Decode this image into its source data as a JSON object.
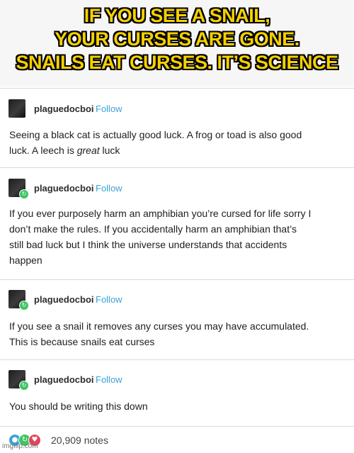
{
  "caption": {
    "lines": [
      "IF YOU SEE A SNAIL,",
      "YOUR CURSES ARE GONE.",
      "SNAILS EAT CURSES. IT’S SCIENCE"
    ]
  },
  "posts": [
    {
      "username": "plaguedocboi",
      "follow_label": "Follow",
      "text_lines": [
        "Seeing a black cat is actually good luck. A frog or toad is also good"
      ],
      "tail_before": "luck. A leech is ",
      "tail_em": "great",
      "tail_after": " luck",
      "avatar_icon": "avatar",
      "reblog": false
    },
    {
      "username": "plaguedocboi",
      "follow_label": "Follow",
      "text_lines": [
        "If you ever purposely harm an amphibian you’re cursed for life sorry I",
        "don’t make the rules. If you accidentally harm an amphibian that’s",
        "still bad luck but I think the universe understands that accidents",
        "happen"
      ],
      "reblog": true
    },
    {
      "username": "plaguedocboi",
      "follow_label": "Follow",
      "text_lines": [
        "If you see a snail it removes any curses you may have accumulated.",
        "This is because snails eat curses"
      ],
      "reblog": true
    },
    {
      "username": "plaguedocboi",
      "follow_label": "Follow",
      "text_lines": [
        "You should be writing this down"
      ],
      "reblog": true
    }
  ],
  "notes": {
    "count_label": "20,909 notes",
    "icons": [
      {
        "name": "comment-icon",
        "color": "#3aa2d8"
      },
      {
        "name": "reblog-icon",
        "color": "#3ec563"
      },
      {
        "name": "heart-icon",
        "color": "#e0455b"
      }
    ]
  },
  "watermark": "imgflip.com"
}
